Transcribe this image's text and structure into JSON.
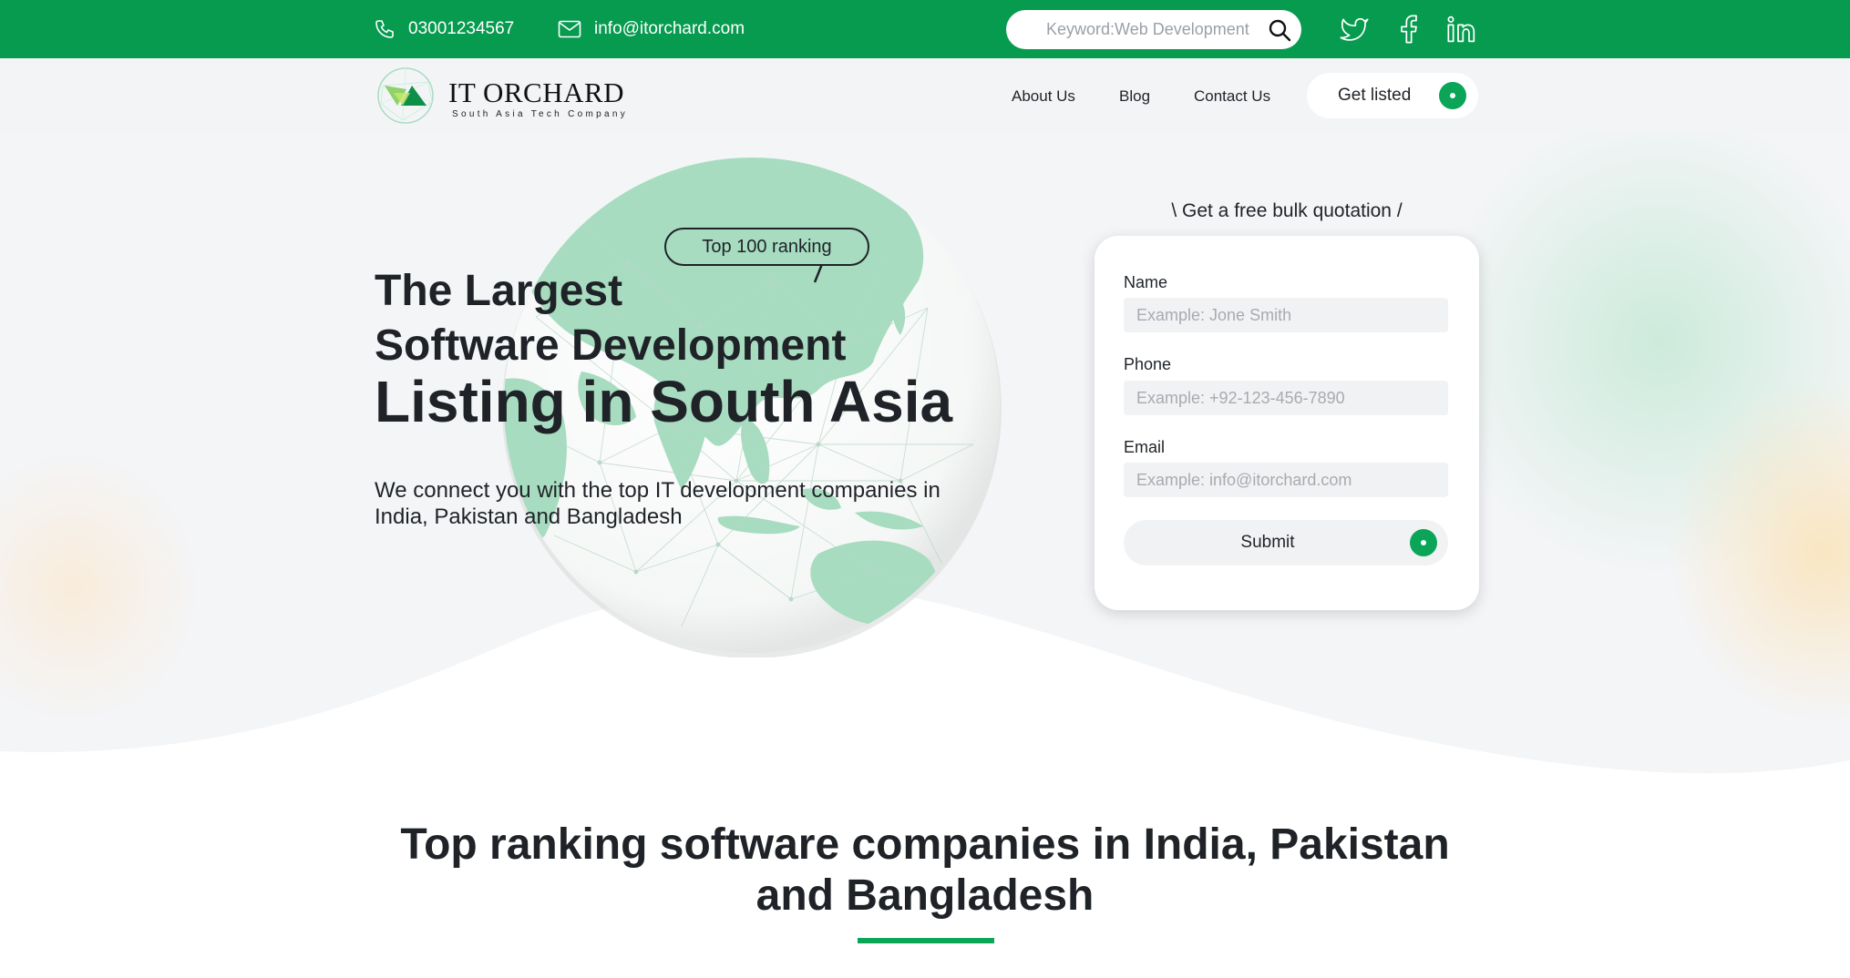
{
  "topbar": {
    "phone": "03001234567",
    "email": "info@itorchard.com",
    "search_placeholder": "Keyword:Web Development",
    "icons": [
      "phone-icon",
      "mail-icon",
      "search-icon",
      "twitter-icon",
      "facebook-icon",
      "linkedin-icon"
    ],
    "background_color": "#069b4f"
  },
  "header": {
    "brand": "IT ORCHARD",
    "tagline": "South Asia Tech Company",
    "nav": {
      "about": "About Us",
      "blog": "Blog",
      "contact": "Contact Us"
    },
    "cta": "Get listed"
  },
  "hero": {
    "badge": "Top 100 ranking",
    "title_line1": "The Largest",
    "title_line2": "Software Development",
    "title_line3": "Listing in South Asia",
    "subtitle": "We connect you with the top IT development companies in India, Pakistan and Bangladesh"
  },
  "quote_form": {
    "title": "\\ Get a free bulk quotation /",
    "name_label": "Name",
    "name_placeholder": "Example: Jone Smith",
    "phone_label": "Phone",
    "phone_placeholder": "Example: +92-123-456-7890",
    "email_label": "Email",
    "email_placeholder": "Example: info@itorchard.com",
    "submit": "Submit"
  },
  "section": {
    "title": "Top ranking software companies in India, Pakistan and Bangladesh"
  },
  "colors": {
    "accent": "#0aa557",
    "topbar": "#069b4f",
    "header_bg": "#f3f4f6",
    "globe_land": "#a7dcc0"
  }
}
